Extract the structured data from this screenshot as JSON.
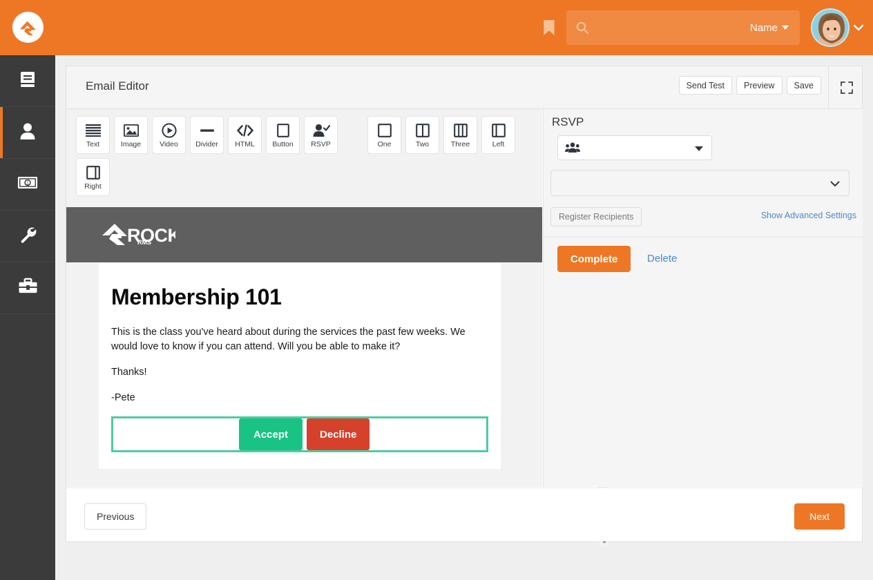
{
  "colors": {
    "brand_orange": "#ee7725",
    "sidebar_dark": "#3b3b3b",
    "accept_green": "#18c383",
    "decline_red": "#d6412c",
    "rsvp_outline_green": "#4ecba0",
    "link_blue": "#4b89d1",
    "email_banner_gray": "#5f5f5f"
  },
  "topbar": {
    "logo_name": "rock-rms-logo",
    "bookmark_icon": "bookmark-icon",
    "search": {
      "icon": "search-icon",
      "value": "",
      "placeholder": "",
      "scope_label": "Name",
      "scope_caret_icon": "caret-down-icon"
    },
    "avatar_name": "user-avatar",
    "user_menu_icon": "chevron-down-icon"
  },
  "sidebar": {
    "items": [
      {
        "icon": "book-icon",
        "name": "cms",
        "active": false
      },
      {
        "icon": "person-icon",
        "name": "people",
        "active": true
      },
      {
        "icon": "money-bill-icon",
        "name": "finance",
        "active": false
      },
      {
        "icon": "wrench-icon",
        "name": "admin-tools",
        "active": false
      },
      {
        "icon": "toolbox-icon",
        "name": "tools",
        "active": false
      }
    ]
  },
  "panel": {
    "title": "Email Editor",
    "actions": [
      {
        "label": "Send Test",
        "name": "send-test-button"
      },
      {
        "label": "Preview",
        "name": "preview-button"
      },
      {
        "label": "Save",
        "name": "save-button"
      }
    ],
    "fullscreen_icon": "fullscreen-icon"
  },
  "palette": {
    "components": [
      {
        "label": "Text",
        "icon": "text-lines-icon"
      },
      {
        "label": "Image",
        "icon": "image-icon"
      },
      {
        "label": "Video",
        "icon": "play-circle-icon"
      },
      {
        "label": "Divider",
        "icon": "divider-icon"
      },
      {
        "label": "HTML",
        "icon": "code-icon"
      },
      {
        "label": "Button",
        "icon": "square-button-icon"
      },
      {
        "label": "RSVP",
        "icon": "person-check-icon"
      }
    ],
    "layouts": [
      {
        "label": "One",
        "icon": "one-column-icon"
      },
      {
        "label": "Two",
        "icon": "two-column-icon"
      },
      {
        "label": "Three",
        "icon": "three-column-icon"
      },
      {
        "label": "Left",
        "icon": "left-sidebar-column-icon"
      },
      {
        "label": "Right",
        "icon": "right-sidebar-column-icon"
      }
    ]
  },
  "email": {
    "banner_logo": "rock-rms-wordmark",
    "banner_logo_text": "ROCK",
    "banner_logo_subtext": "RMS",
    "heading": "Membership 101",
    "paragraph1": "This is the class you've heard about during the services the past few weeks. We would love to know if you can attend. Will you be able to make it?",
    "paragraph2": "Thanks!",
    "paragraph3": "-Pete",
    "rsvp": {
      "accept_label": "Accept",
      "decline_label": "Decline"
    }
  },
  "scrollbar": {
    "up_icon": "scroll-up-arrow-icon",
    "down_icon": "scroll-down-arrow-icon",
    "thumb_name": "scrollbar-thumb"
  },
  "properties": {
    "title": "RSVP",
    "group_select": {
      "icon": "users-group-icon",
      "value": "",
      "caret_icon": "caret-down-icon"
    },
    "occurrence_select": {
      "value": "",
      "caret_icon": "chevron-down-icon"
    },
    "register_recipients_label": "Register Recipients",
    "advanced_settings_label": "Show Advanced Settings",
    "complete_label": "Complete",
    "delete_label": "Delete"
  },
  "wizard_footer": {
    "previous_label": "Previous",
    "next_label": "Next"
  }
}
